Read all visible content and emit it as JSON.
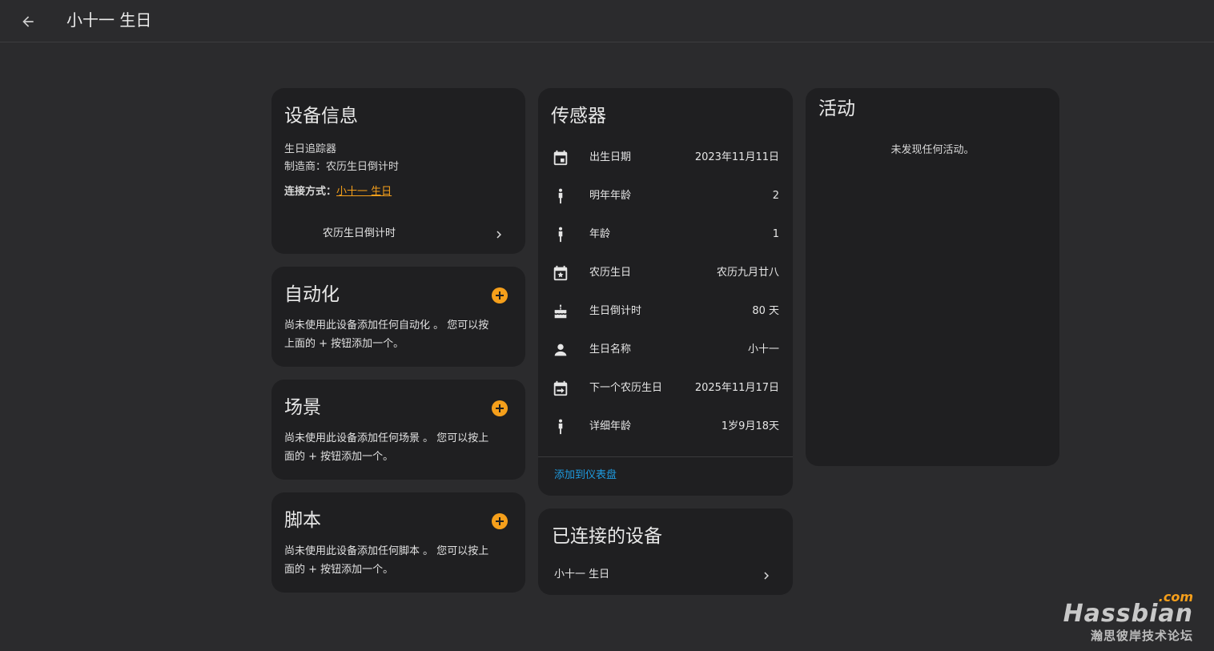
{
  "header": {
    "title": "小十一 生日"
  },
  "device_info": {
    "title": "设备信息",
    "model": "生日追踪器",
    "manufacturer_label": "制造商：",
    "manufacturer": "农历生日倒计时",
    "connection_label": "连接方式：",
    "connection_link": "小十一 生日",
    "integration_label": "农历生日倒计时"
  },
  "automation": {
    "title": "自动化",
    "desc_line1": "尚未使用此设备添加任何自动化 。 您可以按",
    "desc_line2": "上面的 + 按钮添加一个。"
  },
  "scenes": {
    "title": "场景",
    "desc_line1": "尚未使用此设备添加任何场景 。 您可以按上",
    "desc_line2": "面的 + 按钮添加一个。"
  },
  "scripts": {
    "title": "脚本",
    "desc_line1": "尚未使用此设备添加任何脚本 。 您可以按上",
    "desc_line2": "面的 + 按钮添加一个。"
  },
  "sensors": {
    "title": "传感器",
    "rows": [
      {
        "icon": "calendar-icon",
        "name": "出生日期",
        "value": "2023年11月11日"
      },
      {
        "icon": "human-icon",
        "name": "明年年龄",
        "value": "2"
      },
      {
        "icon": "human-icon",
        "name": "年龄",
        "value": "1"
      },
      {
        "icon": "calendar-star-icon",
        "name": "农历生日",
        "value": "农历九月廿八"
      },
      {
        "icon": "cake-icon",
        "name": "生日倒计时",
        "value": "80 天"
      },
      {
        "icon": "account-icon",
        "name": "生日名称",
        "value": "小十一"
      },
      {
        "icon": "calendar-arrow-icon",
        "name": "下一个农历生日",
        "value": "2025年11月17日"
      },
      {
        "icon": "human-icon",
        "name": "详细年龄",
        "value": "1岁9月18天"
      }
    ],
    "add_to_dashboard": "添加到仪表盘"
  },
  "connected_devices": {
    "title": "已连接的设备",
    "item": "小十一 生日"
  },
  "activity": {
    "title": "活动",
    "empty": "未发现任何活动。"
  },
  "watermark": {
    "brand": "Hassbian",
    "suffix": ".com",
    "subtitle": "瀚思彼岸技术论坛"
  },
  "colors": {
    "accent": "#f59f1b",
    "link_blue": "#1e9be0",
    "card_bg": "#1f1f21",
    "page_bg": "#2b2b2d"
  }
}
